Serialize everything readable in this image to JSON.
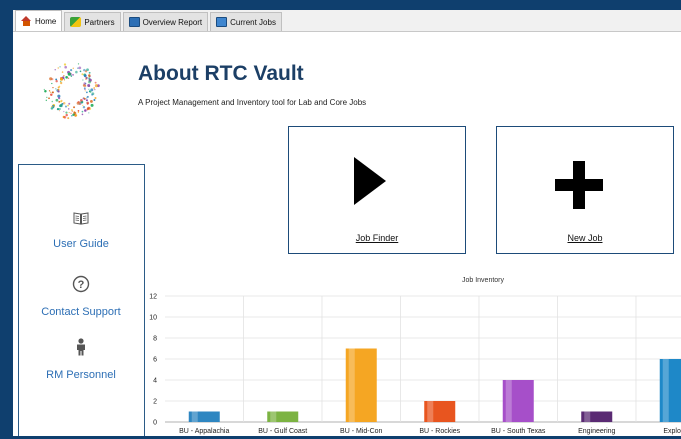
{
  "tabs": [
    {
      "label": "Home",
      "icon": "home-icon",
      "active": true
    },
    {
      "label": "Partners",
      "icon": "partners-icon",
      "active": false
    },
    {
      "label": "Overview Report",
      "icon": "report-icon",
      "active": false
    },
    {
      "label": "Current Jobs",
      "icon": "jobs-icon",
      "active": false
    }
  ],
  "header": {
    "title": "About RTC Vault",
    "subtitle": "A Project Management and Inventory tool for Lab and Core Jobs"
  },
  "sidebar": {
    "items": [
      {
        "label": "User Guide",
        "icon": "book-icon"
      },
      {
        "label": "Contact Support",
        "icon": "help-icon"
      },
      {
        "label": "RM Personnel",
        "icon": "person-icon"
      }
    ]
  },
  "actions": {
    "job_finder": "Job Finder",
    "new_job": "New Job"
  },
  "chart_data": {
    "type": "bar",
    "title": "Job Inventory",
    "categories": [
      "BU - Appalachia",
      "BU - Gulf Coast",
      "BU - Mid-Con",
      "BU - Rockies",
      "BU - South Texas",
      "Engineering",
      "Explora"
    ],
    "values": [
      1,
      1,
      7,
      2,
      4,
      1,
      6
    ],
    "colors": [
      "#2e86c1",
      "#7cb342",
      "#f5a623",
      "#e8551f",
      "#a64fc9",
      "#5a2a73",
      "#1e88c8"
    ],
    "ylim": [
      0,
      12
    ],
    "yticks": [
      0,
      2,
      4,
      6,
      8,
      10,
      12
    ],
    "grid": true,
    "xlabel": "",
    "ylabel": ""
  }
}
